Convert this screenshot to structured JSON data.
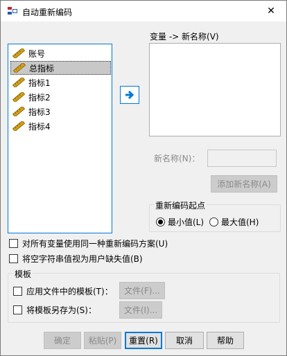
{
  "window": {
    "title": "自动重新编码",
    "close_glyph": "✕"
  },
  "variables": {
    "items": [
      {
        "label": "账号",
        "icon": "ruler-icon",
        "selected": false
      },
      {
        "label": "总指标",
        "icon": "ruler-icon",
        "selected": true
      },
      {
        "label": "指标1",
        "icon": "ruler-icon",
        "selected": false
      },
      {
        "label": "指标2",
        "icon": "ruler-icon",
        "selected": false
      },
      {
        "label": "指标3",
        "icon": "ruler-icon",
        "selected": false
      },
      {
        "label": "指标4",
        "icon": "ruler-icon",
        "selected": false
      }
    ]
  },
  "move_button": {
    "icon": "right-arrow-icon"
  },
  "right_panel": {
    "list_label": "变量 -> 新名称(V)",
    "new_name_label": "新名称(N)：",
    "new_name_value": "",
    "add_button": "添加新名称(A)"
  },
  "start_point": {
    "title": "重新编码起点",
    "lowest_label": "最小值(L)",
    "highest_label": "最大值(H)",
    "selected": "lowest"
  },
  "options": {
    "same_scheme_label": "对所有变量使用同一种重新编码方案(U)",
    "blank_as_missing_label": "将空字符串值视为用户缺失值(B)"
  },
  "template": {
    "title": "模板",
    "apply_label": "应用文件中的模板(T)：",
    "apply_file_button": "文件(F)...",
    "save_label": "将模板另存为(S)：",
    "save_file_button": "文件(I)..."
  },
  "buttons": {
    "ok": "确定",
    "paste": "粘贴(P)",
    "reset": "重置(R)",
    "cancel": "取消",
    "help": "帮助"
  },
  "colors": {
    "accent": "#0078d7",
    "selection": "#c8c8c8",
    "ruler": "#d4a017",
    "disabled_text": "#8a8a8a"
  }
}
